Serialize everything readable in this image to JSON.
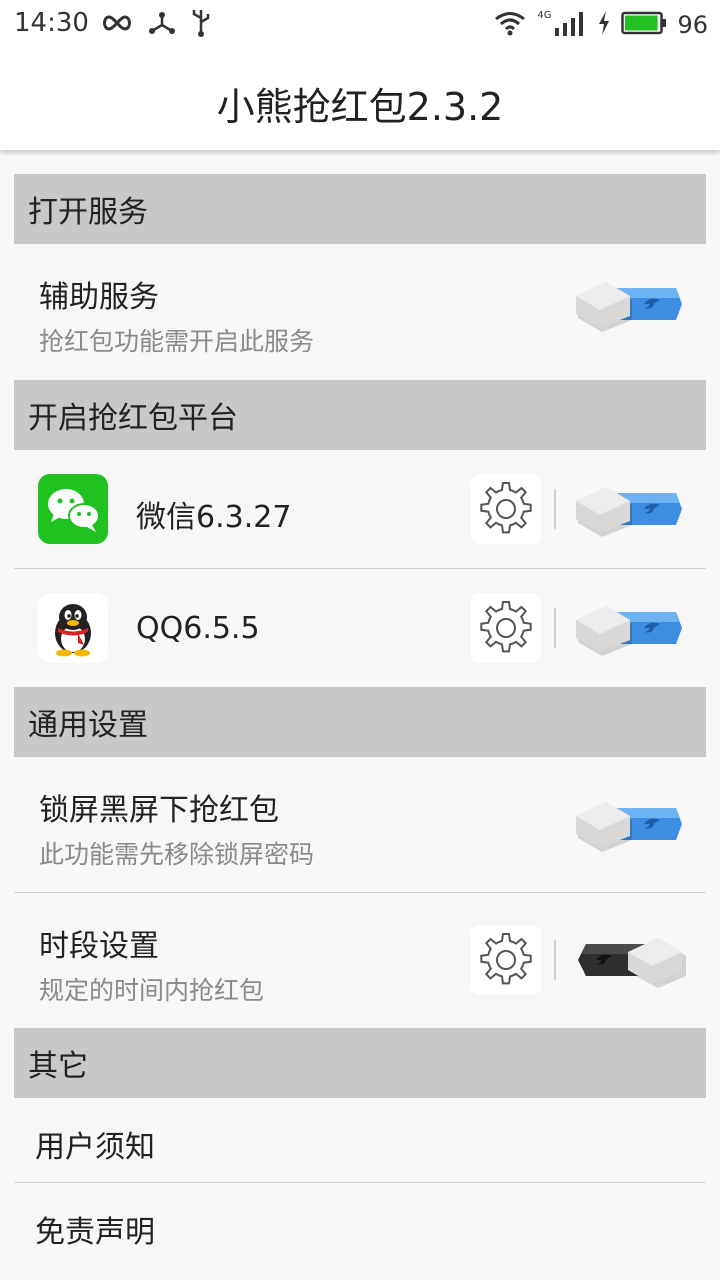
{
  "status_bar": {
    "time": "14:30",
    "battery_level": "96",
    "battery_fraction": 0.96,
    "network": "4G",
    "icons": [
      "infinity-icon",
      "share-icon",
      "usb-icon",
      "wifi-icon",
      "signal-icon",
      "charging-icon",
      "battery-icon"
    ]
  },
  "app_bar": {
    "title": "小熊抢红包2.3.2"
  },
  "sections": {
    "service": {
      "header": "打开服务",
      "accessibility": {
        "title": "辅助服务",
        "subtitle": "抢红包功能需开启此服务",
        "enabled": true
      }
    },
    "platforms": {
      "header": "开启抢红包平台",
      "wechat": {
        "title": "微信6.3.27",
        "enabled": true,
        "icon": "wechat-icon"
      },
      "qq": {
        "title": "QQ6.5.5",
        "enabled": true,
        "icon": "qq-penguin-icon"
      }
    },
    "general": {
      "header": "通用设置",
      "lockscreen": {
        "title": "锁屏黑屏下抢红包",
        "subtitle": "此功能需先移除锁屏密码",
        "enabled": true
      },
      "schedule": {
        "title": "时段设置",
        "subtitle": "规定的时间内抢红包",
        "enabled": false
      }
    },
    "other": {
      "header": "其它",
      "notice": {
        "title": "用户须知"
      },
      "disclaimer": {
        "title": "免责声明"
      }
    }
  },
  "colors": {
    "section_header_bg": "#c8c8c8",
    "toggle_on": "#3d8ee0",
    "toggle_off": "#2e2e2e",
    "wechat_green": "#1fc21f",
    "battery_green": "#22c022"
  }
}
